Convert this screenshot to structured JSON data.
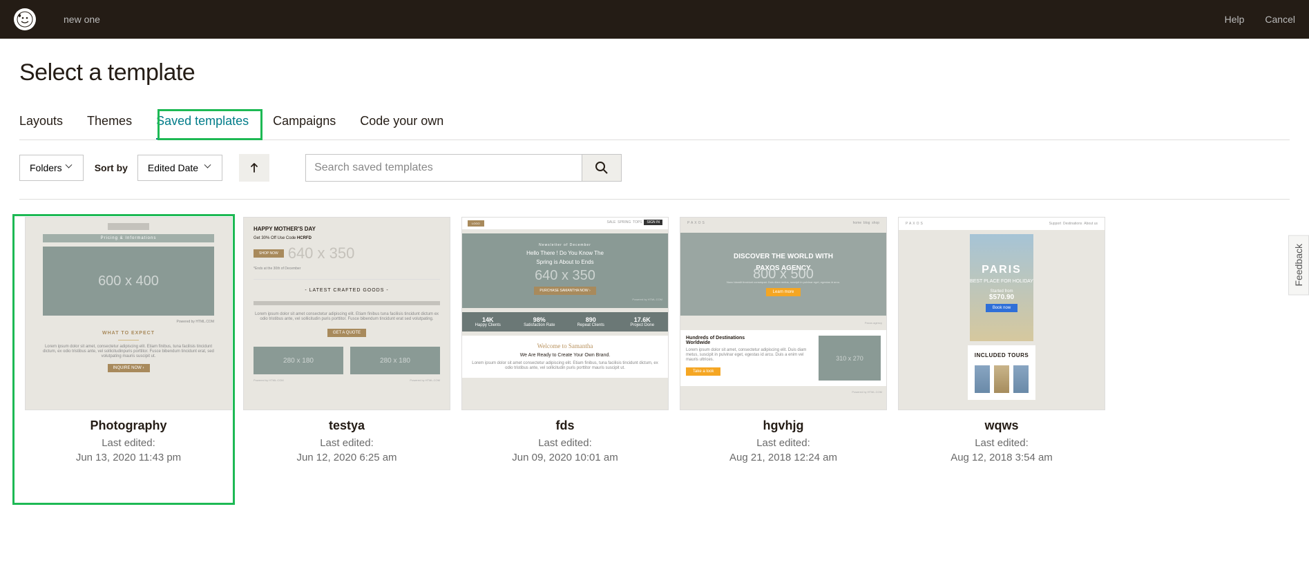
{
  "header": {
    "campaign_name": "new one",
    "help": "Help",
    "cancel": "Cancel"
  },
  "page": {
    "title": "Select a template"
  },
  "tabs": [
    {
      "label": "Layouts"
    },
    {
      "label": "Themes"
    },
    {
      "label": "Saved templates",
      "active": true
    },
    {
      "label": "Campaigns"
    },
    {
      "label": "Code your own"
    }
  ],
  "toolbar": {
    "folders_label": "Folders",
    "sortby_label": "Sort by",
    "sort_value": "Edited Date",
    "search_placeholder": "Search saved templates"
  },
  "templates": [
    {
      "name": "Photography",
      "last_edited_label": "Last edited:",
      "date": "Jun 13, 2020 11:43 pm",
      "highlighted": true
    },
    {
      "name": "testya",
      "last_edited_label": "Last edited:",
      "date": "Jun 12, 2020 6:25 am"
    },
    {
      "name": "fds",
      "last_edited_label": "Last edited:",
      "date": "Jun 09, 2020 10:01 am"
    },
    {
      "name": "hgvhjg",
      "last_edited_label": "Last edited:",
      "date": "Aug 21, 2018 12:24 am"
    },
    {
      "name": "wqws",
      "last_edited_label": "Last edited:",
      "date": "Aug 12, 2018 3:54 am"
    }
  ],
  "feedback_label": "Feedback"
}
